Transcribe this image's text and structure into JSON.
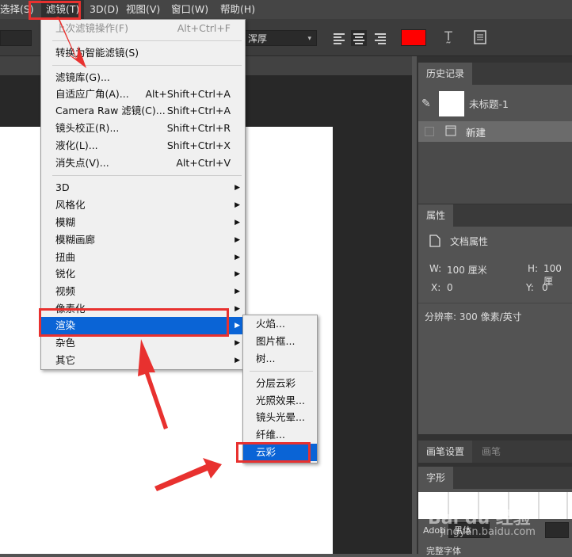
{
  "menubar": {
    "items": [
      "选择(S)",
      "滤镜(T)",
      "3D(D)",
      "视图(V)",
      "窗口(W)",
      "帮助(H)"
    ]
  },
  "options": {
    "font_style": "浑厚",
    "text_color": "#ff0000"
  },
  "filter_menu": {
    "items": [
      {
        "label": "上次滤镜操作(F)",
        "shortcut": "Alt+Ctrl+F",
        "disabled": true
      },
      {
        "label": "转换为智能滤镜(S)"
      },
      {
        "label": "滤镜库(G)..."
      },
      {
        "label": "自适应广角(A)...",
        "shortcut": "Alt+Shift+Ctrl+A"
      },
      {
        "label": "Camera Raw 滤镜(C)...",
        "shortcut": "Shift+Ctrl+A"
      },
      {
        "label": "镜头校正(R)...",
        "shortcut": "Shift+Ctrl+R"
      },
      {
        "label": "液化(L)...",
        "shortcut": "Shift+Ctrl+X"
      },
      {
        "label": "消失点(V)...",
        "shortcut": "Alt+Ctrl+V"
      },
      {
        "label": "3D"
      },
      {
        "label": "风格化"
      },
      {
        "label": "模糊"
      },
      {
        "label": "模糊画廊"
      },
      {
        "label": "扭曲"
      },
      {
        "label": "锐化"
      },
      {
        "label": "视频"
      },
      {
        "label": "像素化"
      },
      {
        "label": "渲染"
      },
      {
        "label": "杂色"
      },
      {
        "label": "其它"
      }
    ]
  },
  "render_submenu": {
    "items": [
      "火焰...",
      "图片框...",
      "树...",
      "分层云彩",
      "光照效果...",
      "镜头光晕...",
      "纤维...",
      "云彩"
    ]
  },
  "history_panel": {
    "tab": "历史记录",
    "snapshot_name": "未标题-1",
    "step": "新建"
  },
  "properties_panel": {
    "tab": "属性",
    "section": "文档属性",
    "w_label": "W:",
    "w_value": "100 厘米",
    "h_label": "H:",
    "h_value": "100 厘",
    "x_label": "X:",
    "x_value": "0",
    "y_label": "Y:",
    "y_value": "0",
    "resolution": "分辨率: 300 像素/英寸"
  },
  "brush_panel": {
    "tabs": [
      "画笔设置",
      "画笔"
    ]
  },
  "glyphs_panel": {
    "tab": "字形",
    "font_prefix": "Adob",
    "font_family": "黑体",
    "bottom_text": "完整字体"
  },
  "watermark": {
    "logo": "Bai du 经验",
    "url": "jingyan.baidu.com"
  }
}
